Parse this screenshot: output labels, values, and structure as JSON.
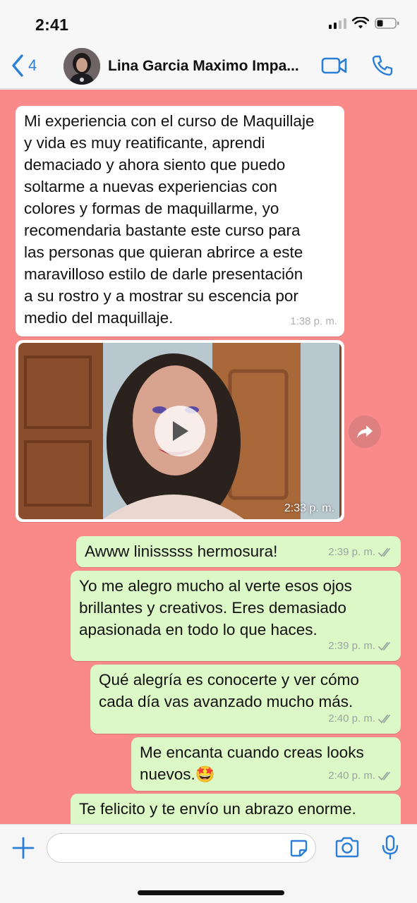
{
  "status_bar": {
    "time": "2:41"
  },
  "header": {
    "back_count": "4",
    "contact_name": "Lina Garcia Maximo Impa..."
  },
  "messages": [
    {
      "direction": "incoming",
      "type": "text",
      "text": "Mi experiencia con el curso de Maquillaje\ny vida es muy reatificante, aprendi\ndemaciado y ahora siento que puedo\nsoltarme a nuevas experiencias con\ncolores y formas de maquillarme, yo\nrecomendaria bastante este curso para\nlas personas que quieran abrirce a este\nmaravilloso estilo de darle presentación\na su rostro y a mostrar su escencia por\nmedio del maquillaje.",
      "time": "1:38 p. m."
    },
    {
      "direction": "incoming",
      "type": "video",
      "time": "2:33 p. m."
    },
    {
      "direction": "outgoing",
      "type": "text",
      "text": "Awww linisssss hermosura!",
      "time": "2:39 p. m."
    },
    {
      "direction": "outgoing",
      "type": "text",
      "text": "Yo me alegro mucho al verte esos ojos\nbrillantes y creativos. Eres demasiado\napasionada en todo lo que haces.",
      "time": "2:39 p. m."
    },
    {
      "direction": "outgoing",
      "type": "text",
      "text": "Qué alegría es conocerte y ver cómo\ncada día vas avanzado mucho más.",
      "time": "2:40 p. m."
    },
    {
      "direction": "outgoing",
      "type": "text",
      "text": "Me encanta cuando creas looks\nnuevos.🤩",
      "time": "2:40 p. m."
    },
    {
      "direction": "outgoing",
      "type": "text",
      "text": "Te felicito y te envío un abrazo enorme.",
      "time": ""
    }
  ],
  "composer": {
    "placeholder": ""
  },
  "icons": {
    "back": "chevron-left-icon",
    "video_call": "video-camera-icon",
    "voice_call": "phone-icon",
    "forward": "forward-icon",
    "play": "play-icon",
    "add": "plus-icon",
    "sticker": "sticker-icon",
    "camera": "camera-icon",
    "mic": "microphone-icon",
    "read": "double-check-icon"
  },
  "colors": {
    "accent": "#2b7fd6",
    "chat_background": "#f98a89",
    "incoming_bubble": "#ffffff",
    "outgoing_bubble": "#dcf8c6"
  }
}
